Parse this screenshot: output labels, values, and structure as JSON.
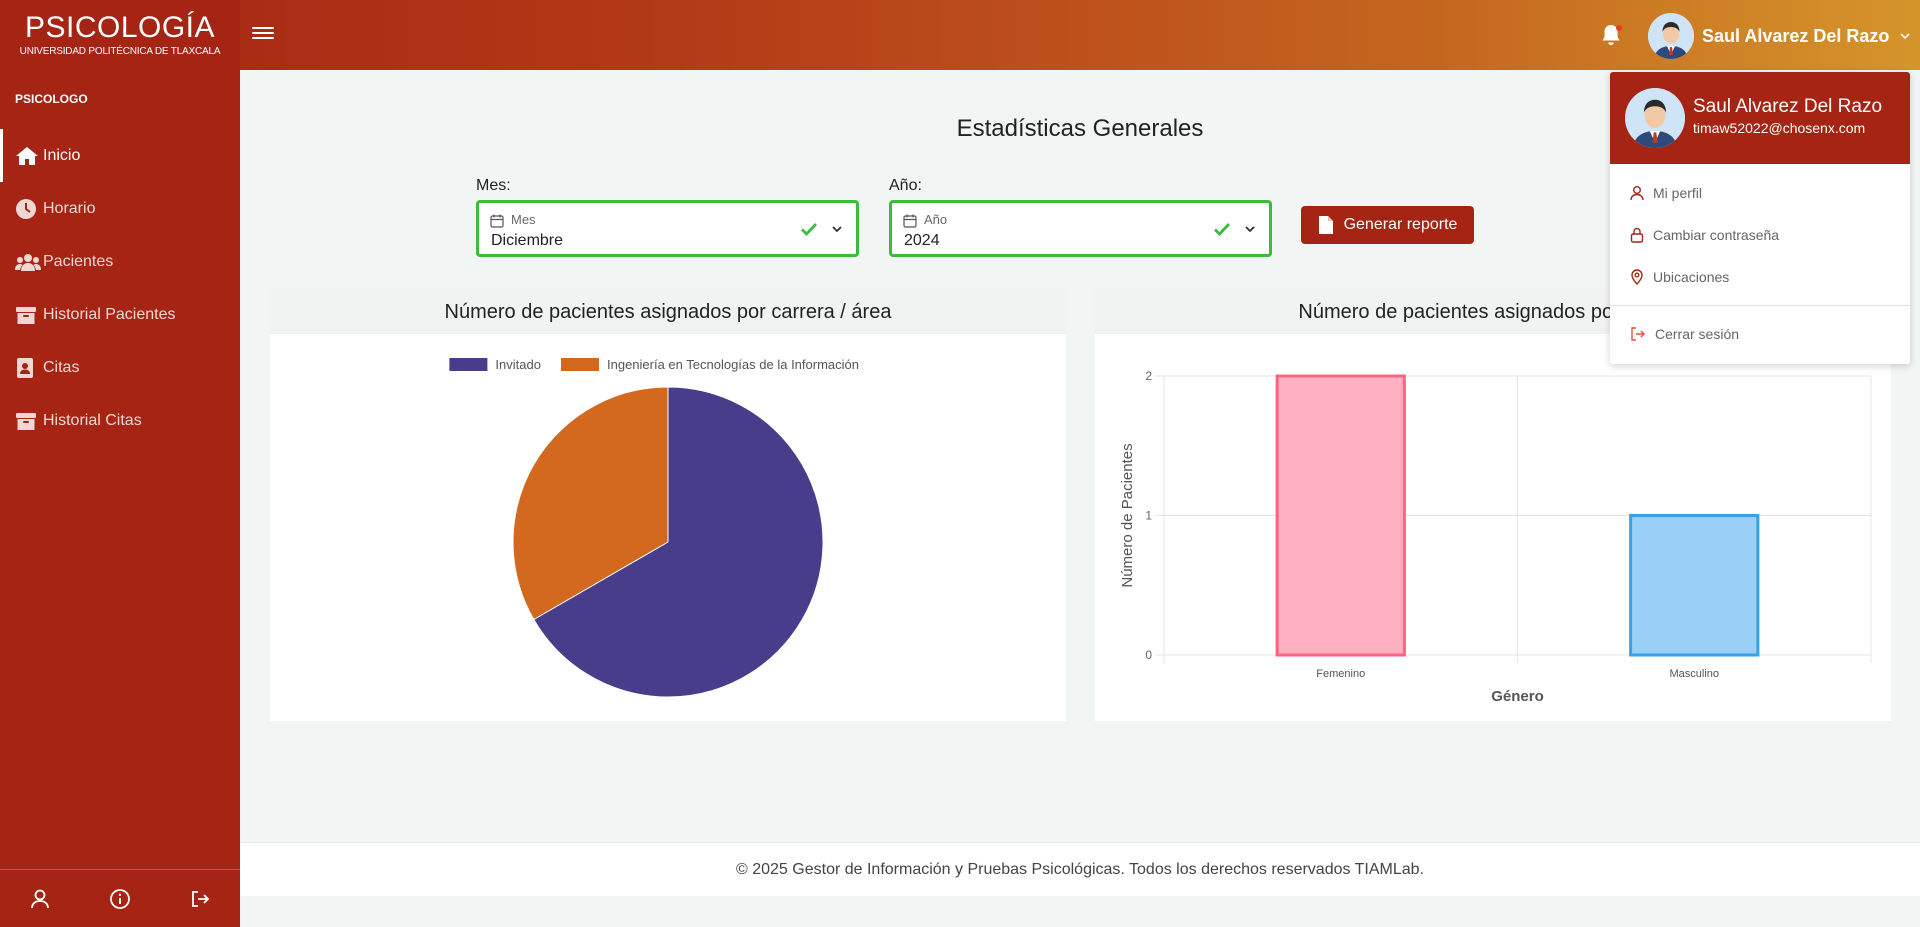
{
  "brand": {
    "title": "PSICOLOGÍA",
    "subtitle": "UNIVERSIDAD POLITÉCNICA DE TLAXCALA"
  },
  "topbar": {
    "user_name": "Saul Alvarez Del Razo"
  },
  "sidebar": {
    "role": "PSICOLOGO",
    "items": [
      {
        "label": "Inicio",
        "icon": "home-icon",
        "active": true
      },
      {
        "label": "Horario",
        "icon": "clock-icon"
      },
      {
        "label": "Pacientes",
        "icon": "users-icon"
      },
      {
        "label": "Historial Pacientes",
        "icon": "archive-icon"
      },
      {
        "label": "Citas",
        "icon": "contact-book-icon"
      },
      {
        "label": "Historial Citas",
        "icon": "archive-icon"
      }
    ],
    "bottom_icons": [
      "user-icon",
      "info-icon",
      "logout-icon"
    ]
  },
  "main": {
    "title": "Estadísticas Generales",
    "month_label": "Mes:",
    "month_placeholder": "Mes",
    "month_value": "Diciembre",
    "year_label": "Año:",
    "year_placeholder": "Año",
    "year_value": "2024",
    "report_button": "Generar reporte"
  },
  "cards": {
    "pie_title": "Número de pacientes asignados por carrera / área",
    "bar_title": "Número de pacientes asignados por género"
  },
  "chart_data": [
    {
      "type": "pie",
      "title": "Número de pacientes asignados por carrera / área",
      "labels": [
        "Invitado",
        "Ingeniería en Tecnologías de la Información"
      ],
      "values": [
        2,
        1
      ],
      "colors": [
        "#483d8b",
        "#d2691e"
      ],
      "legend": "top"
    },
    {
      "type": "bar",
      "title": "Número de pacientes asignados por género",
      "categories": [
        "Femenino",
        "Masculino"
      ],
      "values": [
        2,
        1
      ],
      "colors": [
        "#ffb1c1",
        "#9ad0f5"
      ],
      "border_colors": [
        "#ff6384",
        "#36a2eb"
      ],
      "xlabel": "Género",
      "ylabel": "Número de Pacientes",
      "ylim": [
        0,
        2
      ],
      "yticks": [
        "0",
        "1",
        "2"
      ],
      "grid": true
    }
  ],
  "dropdown": {
    "name": "Saul Alvarez Del Razo",
    "email": "timaw52022@chosenx.com",
    "items": [
      "Mi perfil",
      "Cambiar contraseña",
      "Ubicaciones"
    ],
    "logout": "Cerrar sesión"
  },
  "footer": {
    "text": "© 2025 Gestor de Información y Pruebas Psicológicas. Todos los derechos reservados TIAMLab."
  }
}
